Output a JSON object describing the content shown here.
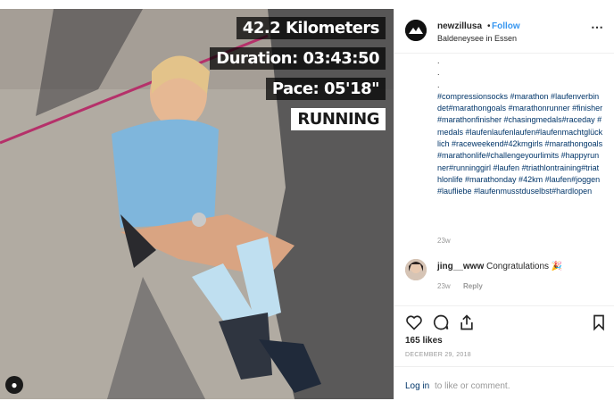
{
  "photo": {
    "overlay_lines": [
      "42.2 Kilometers",
      "Duration: 03:43:50",
      "Pace: 05'18\"",
      "RUNNING"
    ]
  },
  "post": {
    "username": "newzillusa",
    "separator": "•",
    "follow_label": "Follow",
    "location": "Baldeneysee in Essen",
    "more_icon": "⋯",
    "caption_dots": [
      ".",
      ".",
      "."
    ],
    "caption_tags": "#compressionsocks #marathon #laufenverbindet#marathongoals #marathonrunner #finisher#marathonfinisher #chasingmedals#raceday #medals #laufenlaufenlaufen#laufenmachtglücklich #raceweekend#42kmgirls #marathongoals #marathonlife#challengeyourlimits #happyrunner#runninggirl #laufen #triathlontraining#triathlonlife #marathonday #42km #laufen#joggen #laufliebe #laufenmusstduselbst#hardlopen",
    "caption_time": "23w",
    "comment": {
      "user": "jing__www",
      "text": "Congratulations",
      "emoji": "🎉",
      "time": "23w",
      "reply_label": "Reply"
    },
    "likes": "165 likes",
    "date": "DECEMBER 29, 2018",
    "login_link": "Log in",
    "login_rest": "to like or comment."
  },
  "colors": {
    "link": "#003569",
    "follow": "#3897f0",
    "muted": "#999999"
  }
}
